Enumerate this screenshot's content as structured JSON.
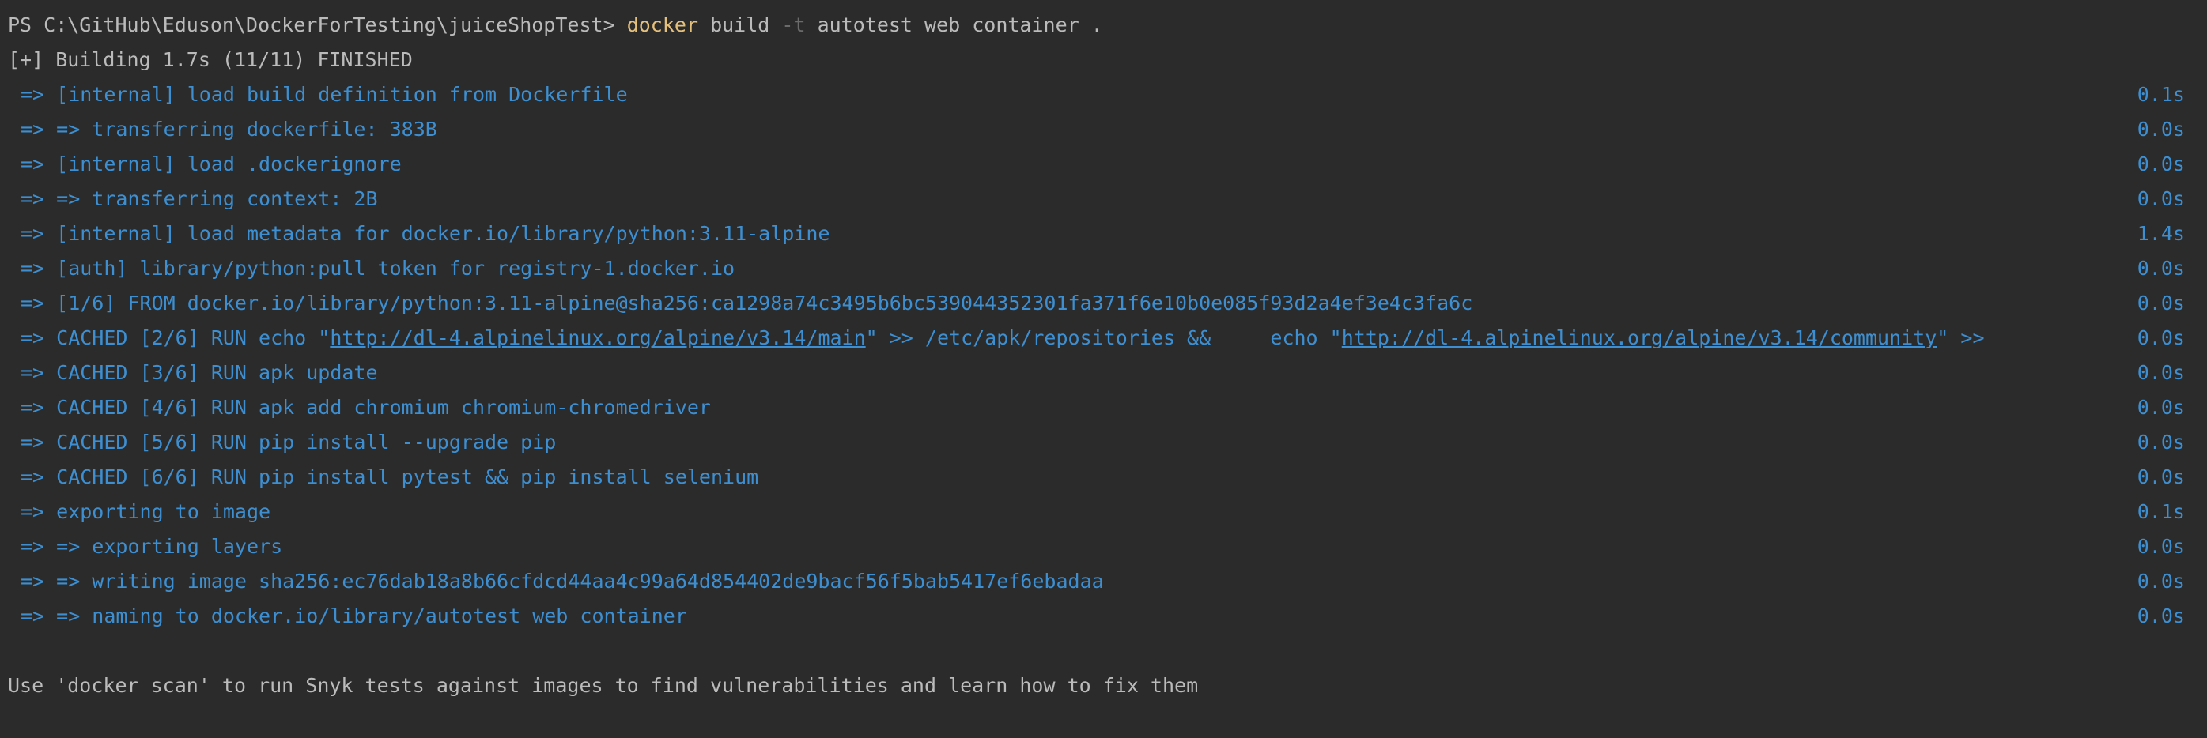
{
  "prompt": {
    "path": "PS C:\\GitHub\\Eduson\\DockerForTesting\\juiceShopTest>",
    "command_docker": "docker",
    "command_build": "build",
    "command_flag": "-t",
    "command_args": "autotest_web_container ."
  },
  "summary": "[+] Building 1.7s (11/11) FINISHED",
  "steps": [
    {
      "text": "=> [internal] load build definition from Dockerfile",
      "duration": "0.1s"
    },
    {
      "text": "=> => transferring dockerfile: 383B",
      "duration": "0.0s"
    },
    {
      "text": "=> [internal] load .dockerignore",
      "duration": "0.0s"
    },
    {
      "text": "=> => transferring context: 2B",
      "duration": "0.0s"
    },
    {
      "text": "=> [internal] load metadata for docker.io/library/python:3.11-alpine",
      "duration": "1.4s"
    },
    {
      "text": "=> [auth] library/python:pull token for registry-1.docker.io",
      "duration": "0.0s"
    },
    {
      "text": "=> [1/6] FROM docker.io/library/python:3.11-alpine@sha256:ca1298a74c3495b6bc539044352301fa371f6e10b0e085f93d2a4ef3e4c3fa6c",
      "duration": "0.0s"
    },
    {
      "part1": "=> CACHED [2/6] RUN echo \"",
      "link1": "http://dl-4.alpinelinux.org/alpine/v3.14/main",
      "part2": "\" >> /etc/apk/repositories &&     echo \"",
      "link2": "http://dl-4.alpinelinux.org/alpine/v3.14/community",
      "part3": "\" >>",
      "duration": "0.0s"
    },
    {
      "text": "=> CACHED [3/6] RUN apk update",
      "duration": "0.0s"
    },
    {
      "text": "=> CACHED [4/6] RUN apk add chromium chromium-chromedriver",
      "duration": "0.0s"
    },
    {
      "text": "=> CACHED [5/6] RUN pip install --upgrade pip",
      "duration": "0.0s"
    },
    {
      "text": "=> CACHED [6/6] RUN pip install pytest && pip install selenium",
      "duration": "0.0s"
    },
    {
      "text": "=> exporting to image",
      "duration": "0.1s"
    },
    {
      "text": "=> => exporting layers",
      "duration": "0.0s"
    },
    {
      "text": "=> => writing image sha256:ec76dab18a8b66cfdcd44aa4c99a64d854402de9bacf56f5bab5417ef6ebadaa",
      "duration": "0.0s"
    },
    {
      "text": "=> => naming to docker.io/library/autotest_web_container",
      "duration": "0.0s"
    }
  ],
  "hint": "Use 'docker scan' to run Snyk tests against images to find vulnerabilities and learn how to fix them"
}
